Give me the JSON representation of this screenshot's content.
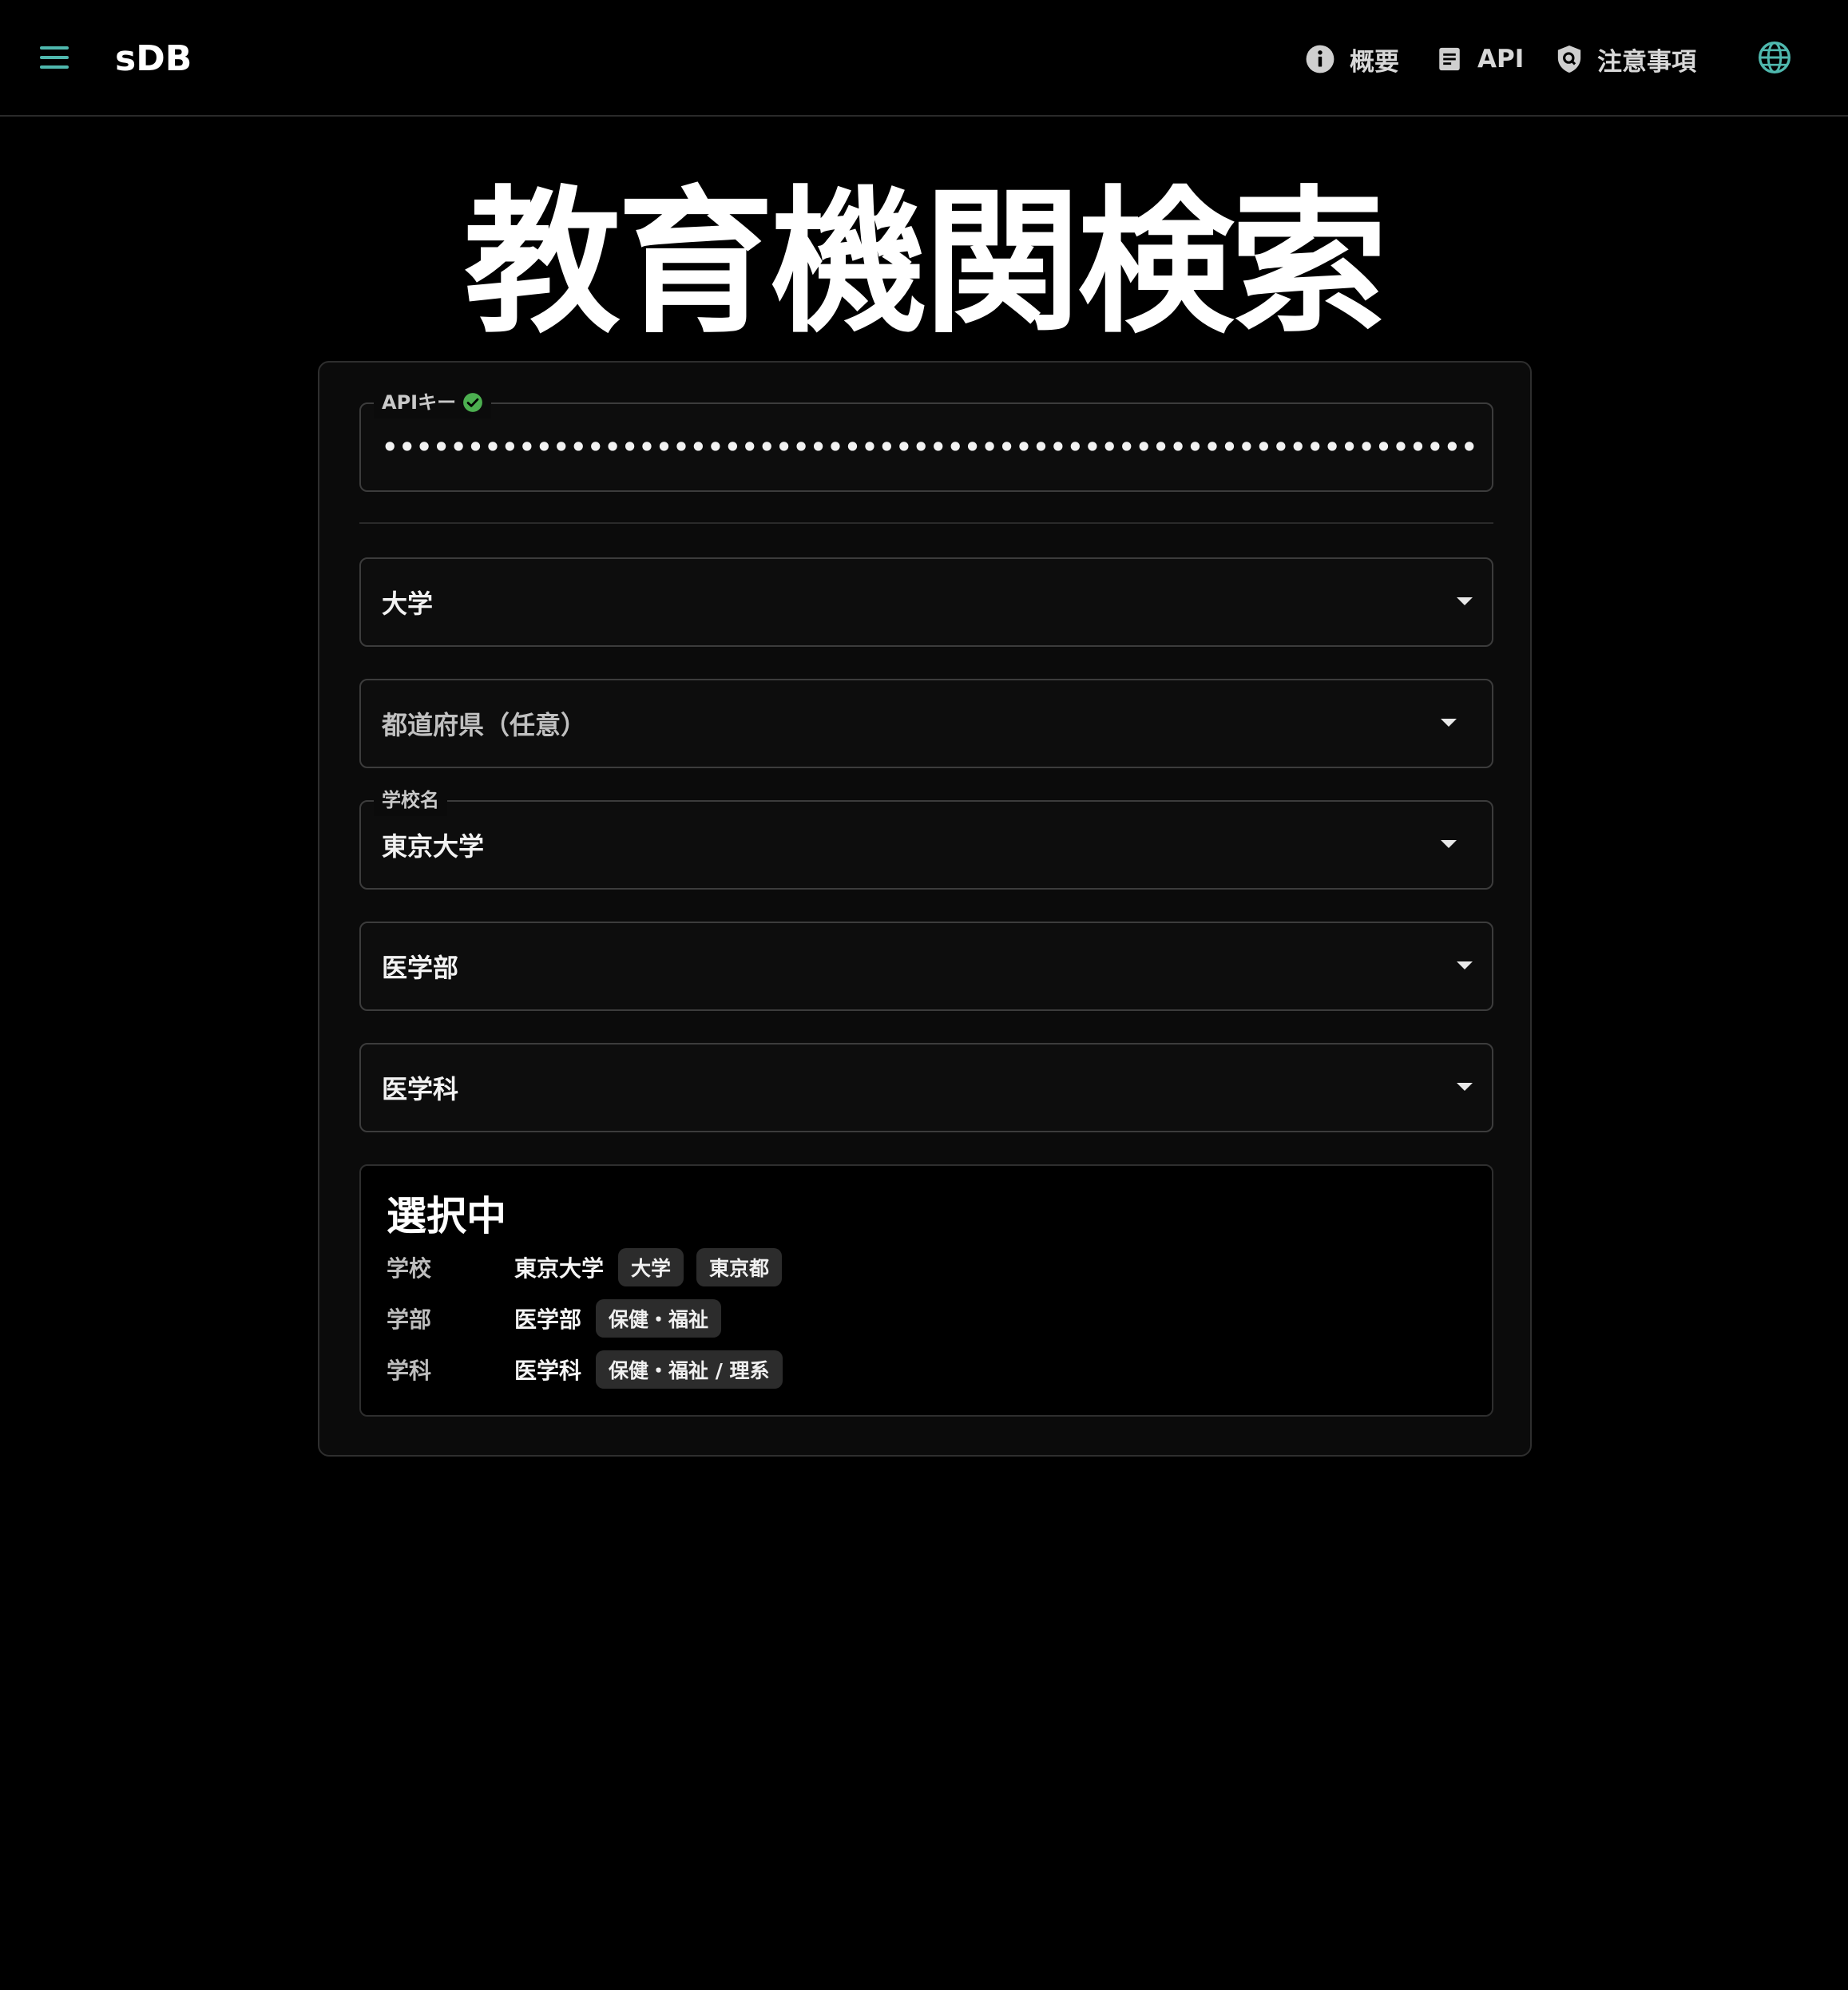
{
  "header": {
    "brand": "sDB",
    "nav": {
      "overview": "概要",
      "api": "API",
      "notes": "注意事項"
    },
    "icons": {
      "menu": "menu-icon",
      "overview": "info-icon",
      "api": "document-icon",
      "notes": "shield-icon",
      "language": "globe-icon"
    },
    "accent_color": "#4fb8ae"
  },
  "title": "教育機関検索",
  "form": {
    "api_key": {
      "label": "APIキー",
      "status_icon": "verified-check-icon",
      "status_color": "#4caf50",
      "value": "••••••••••••••••••••••••••••••••••••••••••••••••••••••••••••••••"
    },
    "school_type": {
      "value": "大学"
    },
    "prefecture": {
      "placeholder": "都道府県（任意）"
    },
    "school_name": {
      "label": "学校名",
      "value": "東京大学"
    },
    "faculty": {
      "value": "医学部"
    },
    "department": {
      "value": "医学科"
    }
  },
  "selected": {
    "title": "選択中",
    "school": {
      "key": "学校",
      "value": "東京大学",
      "chips": [
        "大学",
        "東京都"
      ]
    },
    "faculty": {
      "key": "学部",
      "value": "医学部",
      "chips": [
        "保健・福祉"
      ]
    },
    "department": {
      "key": "学科",
      "value": "医学科",
      "chips": [
        "保健・福祉 / 理系"
      ]
    }
  }
}
